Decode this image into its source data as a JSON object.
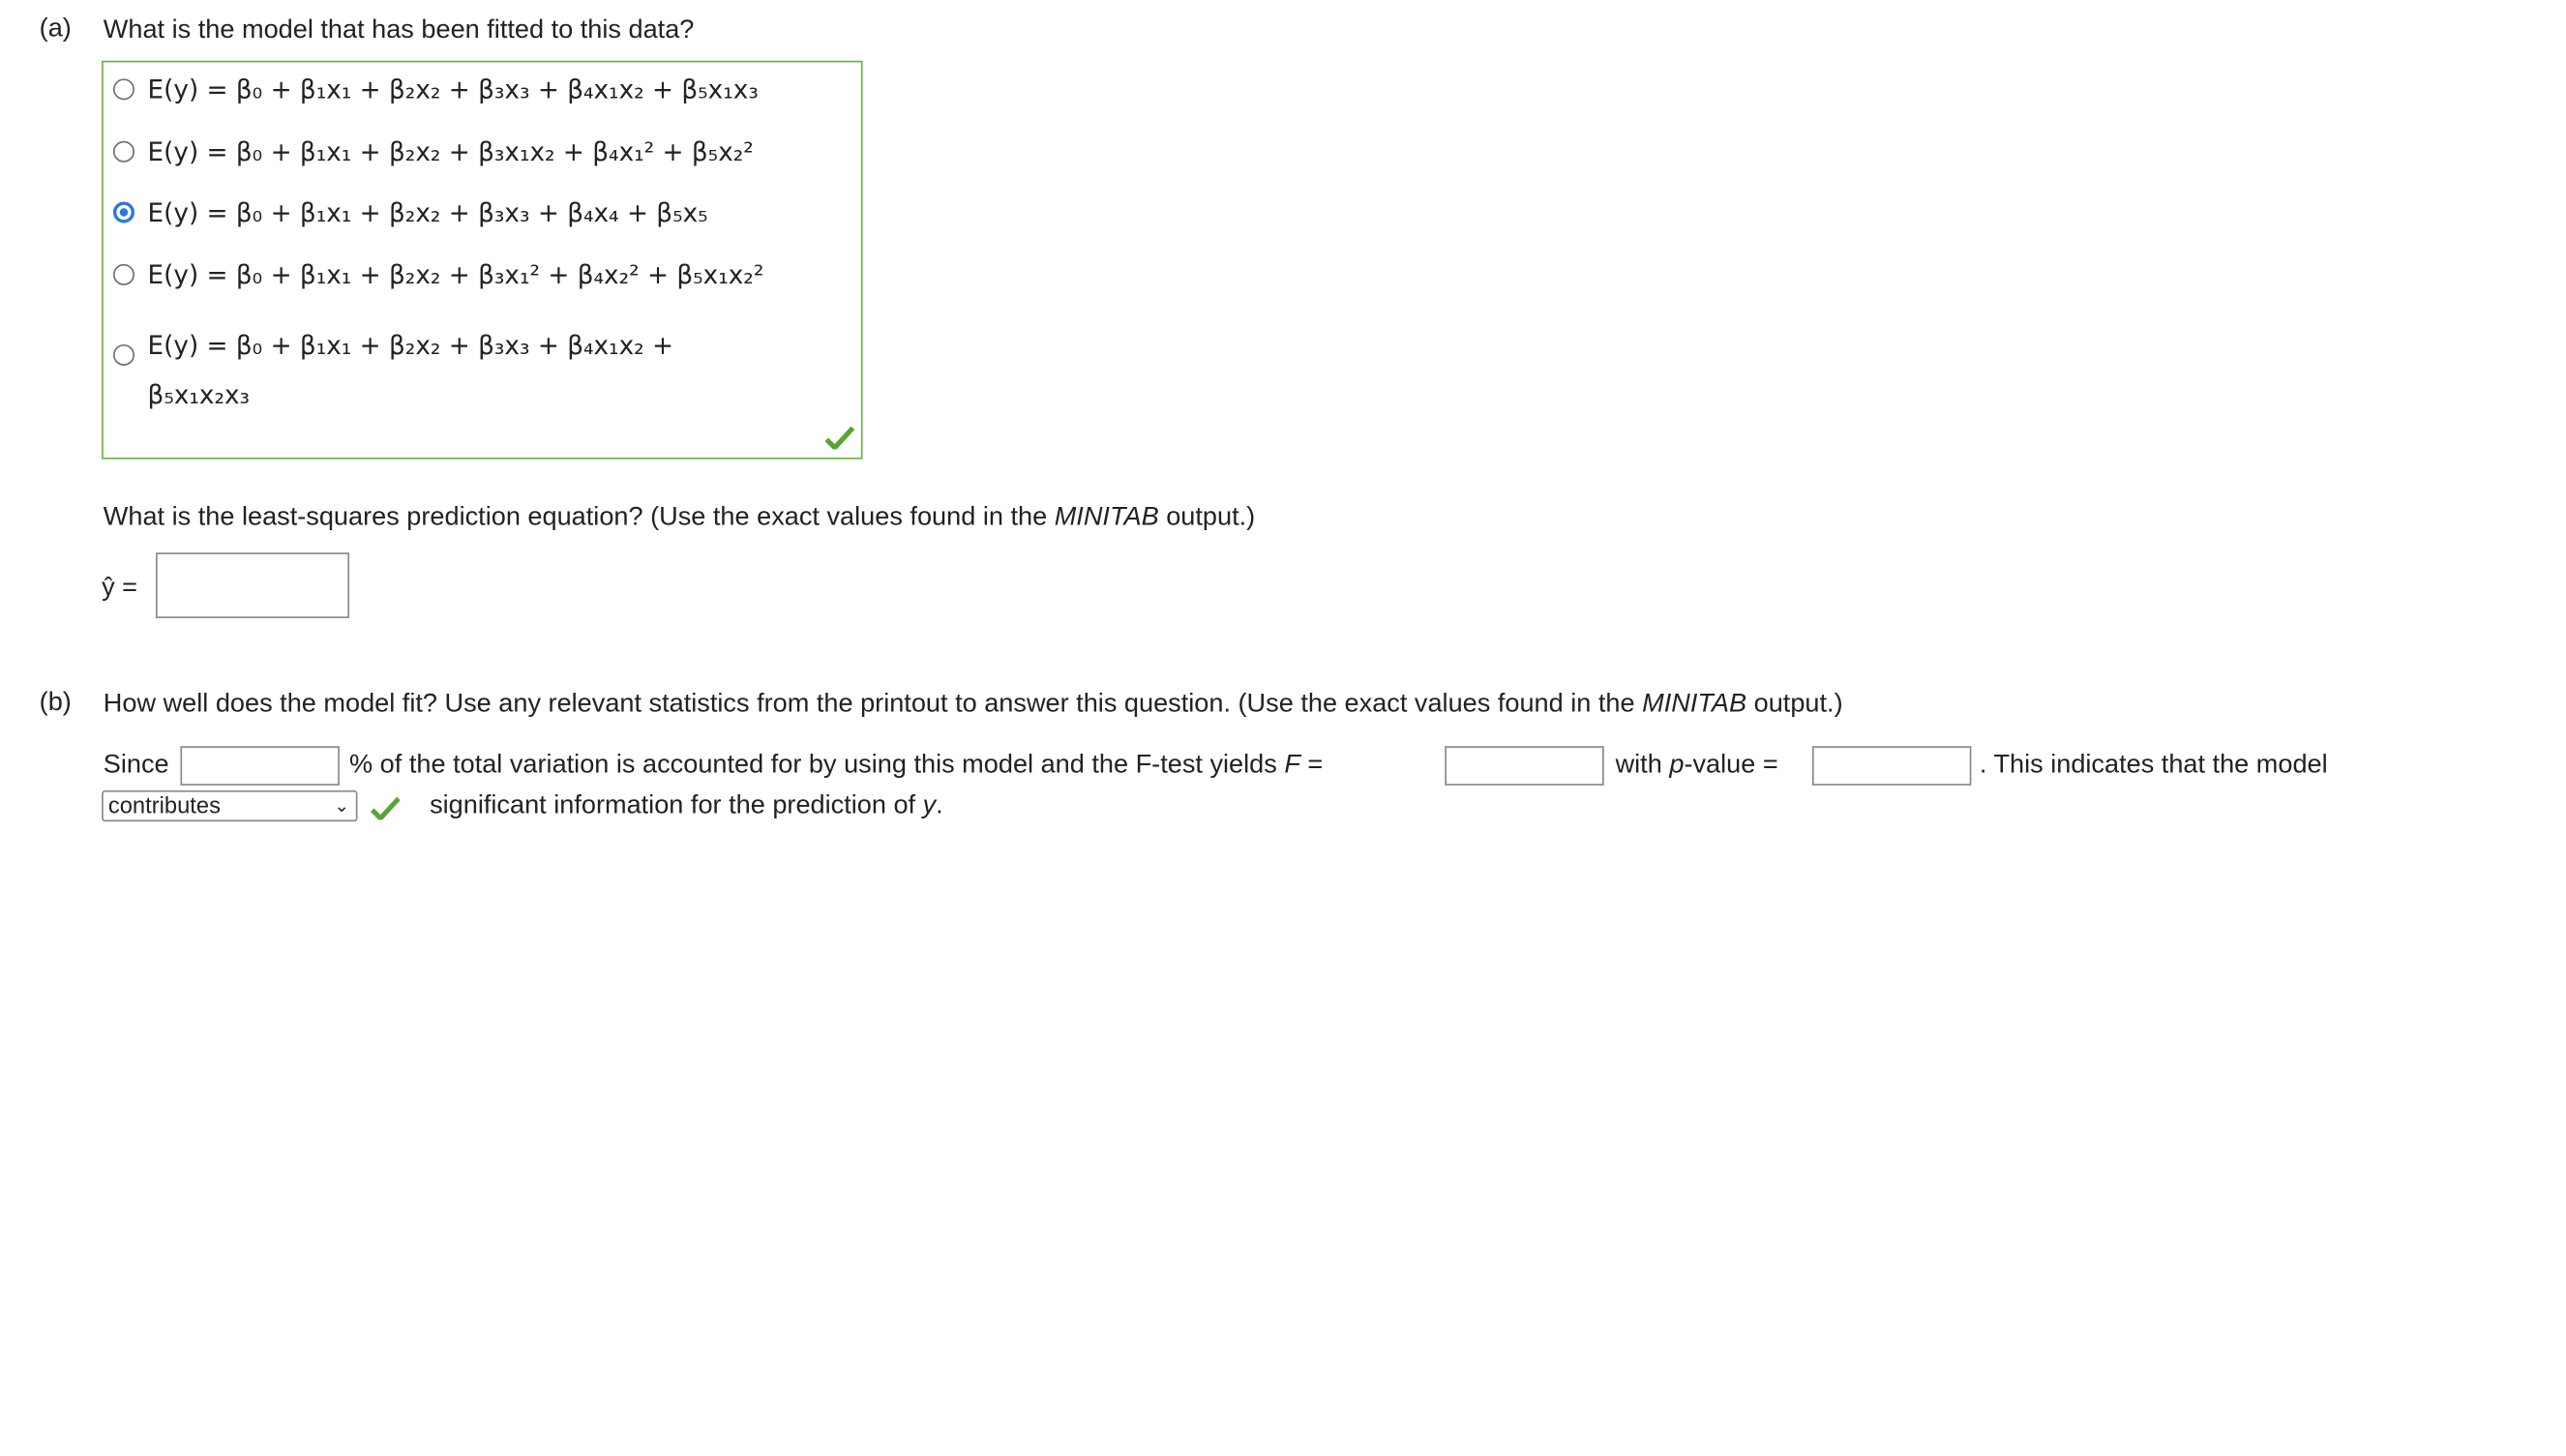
{
  "part_a": {
    "label": "(a)",
    "question": "What is the model that has been fitted to this data?",
    "options": [
      {
        "formula": "E(y) = β₀ + β₁x₁ + β₂x₂ + β₃x₃ + β₄x₁x₂ + β₅x₁x₃",
        "selected": false
      },
      {
        "formula": "E(y) = β₀ + β₁x₁ + β₂x₂ + β₃x₁x₂ + β₄x₁² + β₅x₂²",
        "selected": false
      },
      {
        "formula": "E(y) = β₀ + β₁x₁ + β₂x₂ + β₃x₃ + β₄x₄ + β₅x₅",
        "selected": true
      },
      {
        "formula": "E(y) = β₀ + β₁x₁ + β₂x₂ + β₃x₁² + β₄x₂² + β₅x₁x₂²",
        "selected": false
      },
      {
        "formula_line1": "E(y) = β₀ + β₁x₁ + β₂x₂ + β₃x₃ + β₄x₁x₂ +",
        "formula_line2": "β₅x₁x₂x₃",
        "selected": false
      }
    ],
    "prediction_question": "What is the least-squares prediction equation? (Use the exact values found in the ",
    "software": "MINITAB",
    "prediction_question_end": " output.)",
    "yhat_label": "ŷ =",
    "yhat_value": ""
  },
  "part_b": {
    "label": "(b)",
    "question": "How well does the model fit? Use any relevant statistics from the printout to answer this question. (Use the exact values found in the ",
    "software": "MINITAB",
    "question_end": " output.)",
    "since": "Since",
    "pct_text": "% of the total variation is accounted for by using this model and the F-test yields ",
    "f_label": "F",
    "eq": " =",
    "with": "with ",
    "p_label": "p",
    "pvalue_text": "-value =",
    "indicates": ". This indicates that the model",
    "dropdown_value": "contributes",
    "tail": "significant information for the prediction of ",
    "y": "y",
    "period": ".",
    "r2_value": "",
    "f_value": "",
    "p_value": ""
  },
  "colors": {
    "border_correct": "#6cb244",
    "check": "#5aa336",
    "radio_selected": "#2a77e0"
  },
  "icons": [
    "checkmark-icon",
    "chevron-down-icon"
  ]
}
